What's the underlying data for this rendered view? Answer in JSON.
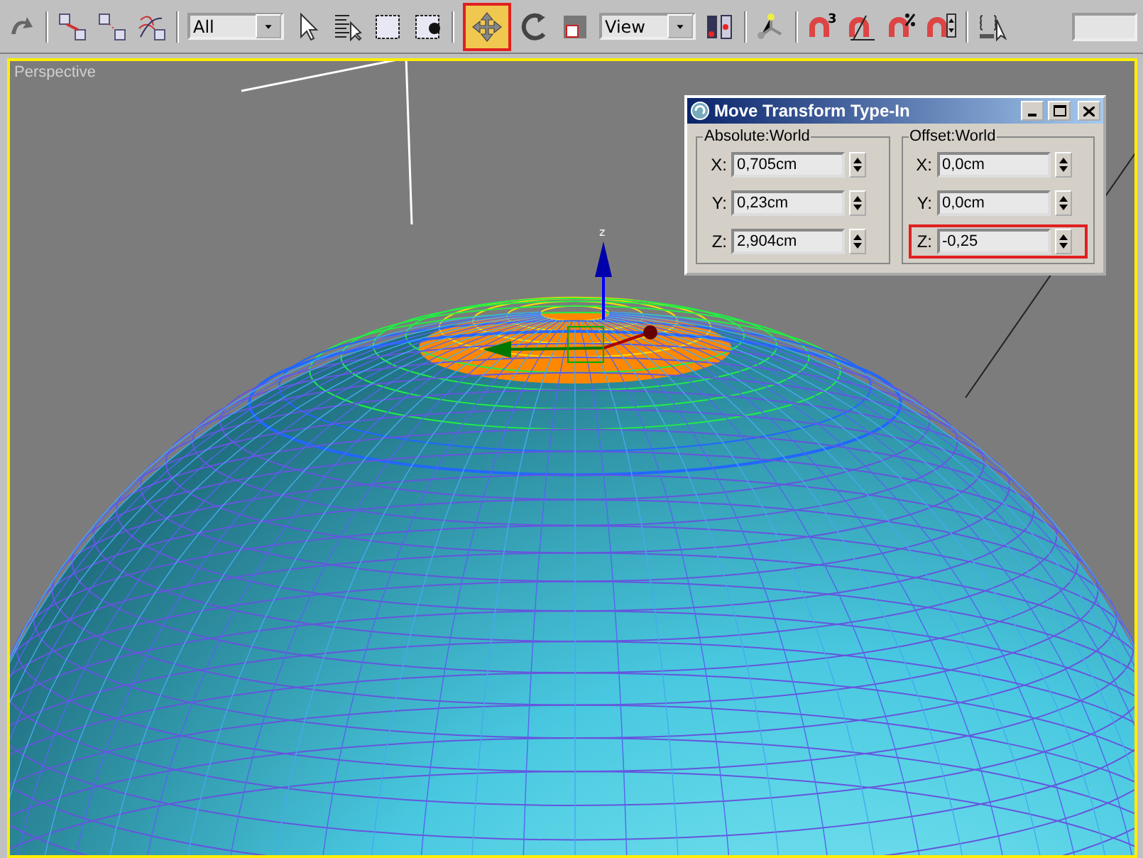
{
  "toolbar": {
    "selection_filter": "All",
    "reference_coordinate_system": "View",
    "snap_mode": "3",
    "move_button": {
      "selected": true,
      "highlighted": true
    }
  },
  "viewport": {
    "label": "Perspective",
    "active": true,
    "gizmo_axis_label": "z"
  },
  "dialog": {
    "title": "Move Transform Type-In",
    "groups": [
      {
        "title": "Absolute:World",
        "fields": [
          {
            "label": "X:",
            "value": "0,705cm",
            "highlighted": false
          },
          {
            "label": "Y:",
            "value": "0,23cm",
            "highlighted": false
          },
          {
            "label": "Z:",
            "value": "2,904cm",
            "highlighted": false
          }
        ]
      },
      {
        "title": "Offset:World",
        "fields": [
          {
            "label": "X:",
            "value": "0,0cm",
            "highlighted": false
          },
          {
            "label": "Y:",
            "value": "0,0cm",
            "highlighted": false
          },
          {
            "label": "Z:",
            "value": "-0,25",
            "highlighted": true
          }
        ]
      }
    ]
  }
}
